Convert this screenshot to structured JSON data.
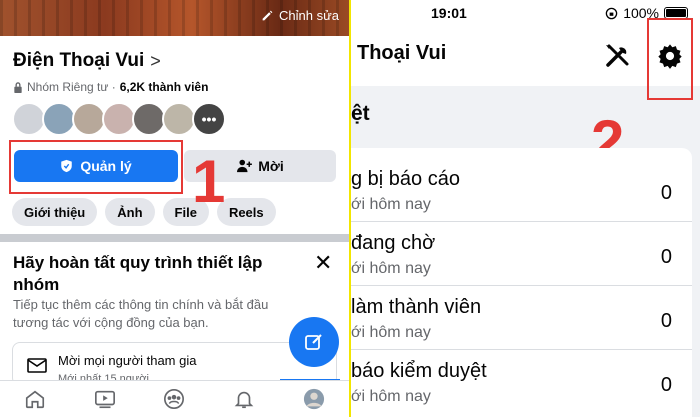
{
  "left": {
    "cover_edit_label": "Chỉnh sửa",
    "group_name": "Điện Thoại Vui",
    "group_chevron": ">",
    "privacy_label": "Nhóm Riêng tư ·",
    "member_count": "6,2K thành viên",
    "manage_label": "Quản lý",
    "invite_label": "Mời",
    "step1_marker": "1",
    "chips": [
      "Giới thiệu",
      "Ảnh",
      "File",
      "Reels"
    ],
    "setup_title": "Hãy hoàn tất quy trình thiết lập nhóm",
    "setup_desc": "Tiếp tục thêm các thông tin chính và bắt đầu tương tác với cộng đồng của bạn.",
    "invite_row_title": "Mời mọi người tham gia",
    "invite_row_sub": "Mới nhất 15 người",
    "tabs": [
      "home-icon",
      "video-icon",
      "groups-icon",
      "notifications-icon",
      "profile-icon"
    ],
    "avatar_colors": [
      "#d0d3d9",
      "#8aa3b8",
      "#b7a89a",
      "#c9b2ae",
      "#6e6a68",
      "#bdb6a8",
      "#444"
    ]
  },
  "right": {
    "time": "19:01",
    "battery": "100%",
    "header_title": "Thoại Vui",
    "step2_marker": "2",
    "section_title": "ệt",
    "rows": [
      {
        "title": "g bị báo cáo",
        "sub": "ới hôm nay",
        "count": "0"
      },
      {
        "title": "đang chờ",
        "sub": "ới hôm nay",
        "count": "0"
      },
      {
        "title": "làm thành viên",
        "sub": "ới hôm nay",
        "count": "0"
      },
      {
        "title": "báo kiểm duyệt",
        "sub": "ới hôm nay",
        "count": "0"
      }
    ]
  },
  "colors": {
    "brand_blue": "#1877f2",
    "annotation_red": "#e53935",
    "separator_yellow": "#f2e600"
  }
}
